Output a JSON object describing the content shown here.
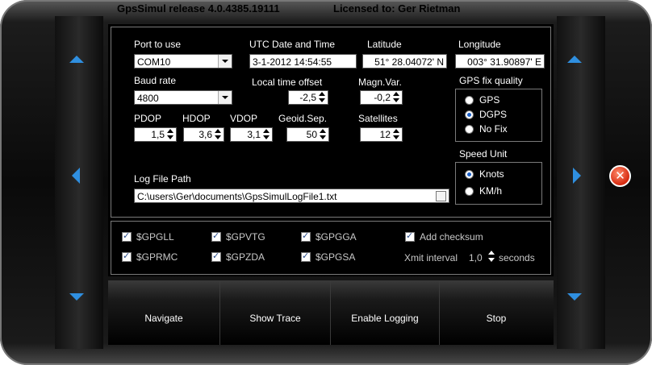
{
  "title": {
    "app": "GpsSimul release 4.0.4385.19111",
    "license": "Licensed to: Ger Rietman"
  },
  "port": {
    "label": "Port to use",
    "value": "COM10"
  },
  "baud": {
    "label": "Baud rate",
    "value": "4800"
  },
  "utc": {
    "label": "UTC Date and Time",
    "value": "3-1-2012 14:54:55"
  },
  "latitude": {
    "label": "Latitude",
    "value": "51° 28.04072' N"
  },
  "longitude": {
    "label": "Longitude",
    "value": "003° 31.90897' E"
  },
  "local_offset": {
    "label": "Local time offset",
    "value": "-2,5"
  },
  "magn_var": {
    "label": "Magn.Var.",
    "value": "-0,2"
  },
  "pdop": {
    "label": "PDOP",
    "value": "1,5"
  },
  "hdop": {
    "label": "HDOP",
    "value": "3,6"
  },
  "vdop": {
    "label": "VDOP",
    "value": "3,1"
  },
  "geoid": {
    "label": "Geoid.Sep.",
    "value": "50"
  },
  "satellites": {
    "label": "Satellites",
    "value": "12"
  },
  "fix_quality": {
    "label": "GPS fix quality",
    "options": [
      "GPS",
      "DGPS",
      "No Fix"
    ],
    "selected": "DGPS"
  },
  "speed_unit": {
    "label": "Speed Unit",
    "options": [
      "Knots",
      "KM/h"
    ],
    "selected": "Knots"
  },
  "log": {
    "label": "Log File Path",
    "value": "C:\\users\\Ger\\documents\\GpsSimulLogFile1.txt"
  },
  "sentences": {
    "gpgll": "$GPGLL",
    "gpvtg": "$GPVTG",
    "gpgga": "$GPGGA",
    "gprmc": "$GPRMC",
    "gpzda": "$GPZDA",
    "gpgsa": "$GPGSA",
    "checksum": "Add checksum"
  },
  "xmit": {
    "label": "Xmit interval",
    "value": "1,0",
    "unit": "seconds"
  },
  "buttons": {
    "navigate": "Navigate",
    "show_trace": "Show Trace",
    "enable_logging": "Enable Logging",
    "stop": "Stop"
  },
  "colors": {
    "accent": "#2f8fe0",
    "close": "#d62a10"
  }
}
